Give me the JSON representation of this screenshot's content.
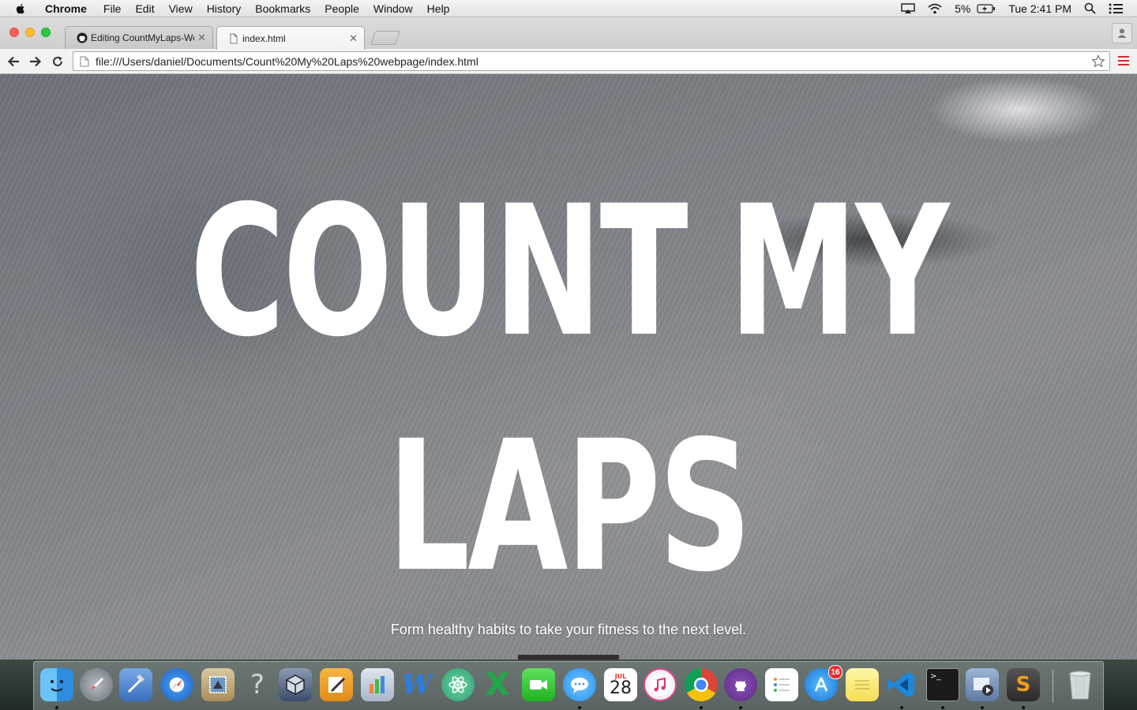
{
  "menubar": {
    "app_name": "Chrome",
    "items": [
      "File",
      "Edit",
      "View",
      "History",
      "Bookmarks",
      "People",
      "Window",
      "Help"
    ],
    "battery_percent": "5%",
    "clock": "Tue 2:41 PM"
  },
  "tabs": [
    {
      "title": "Editing CountMyLaps-Web",
      "icon": "github-icon",
      "active": false
    },
    {
      "title": "index.html",
      "icon": "page-icon",
      "active": true
    }
  ],
  "toolbar": {
    "url": "file:///Users/daniel/Documents/Count%20My%20Laps%20webpage/index.html"
  },
  "page": {
    "hero_line1": "COUNT MY",
    "hero_line2": "LAPS",
    "tagline": "Form healthy habits to take your fitness to the next level."
  },
  "dock": {
    "calendar_month": "JUL",
    "calendar_day": "28",
    "app_store_badge": "16",
    "help_glyph": "?"
  },
  "colors": {
    "close": "#fc5f57",
    "minimize": "#fdbc2e",
    "zoom": "#29c940",
    "chrome_menu": "#d52a2a",
    "hero_text": "#ffffff"
  }
}
